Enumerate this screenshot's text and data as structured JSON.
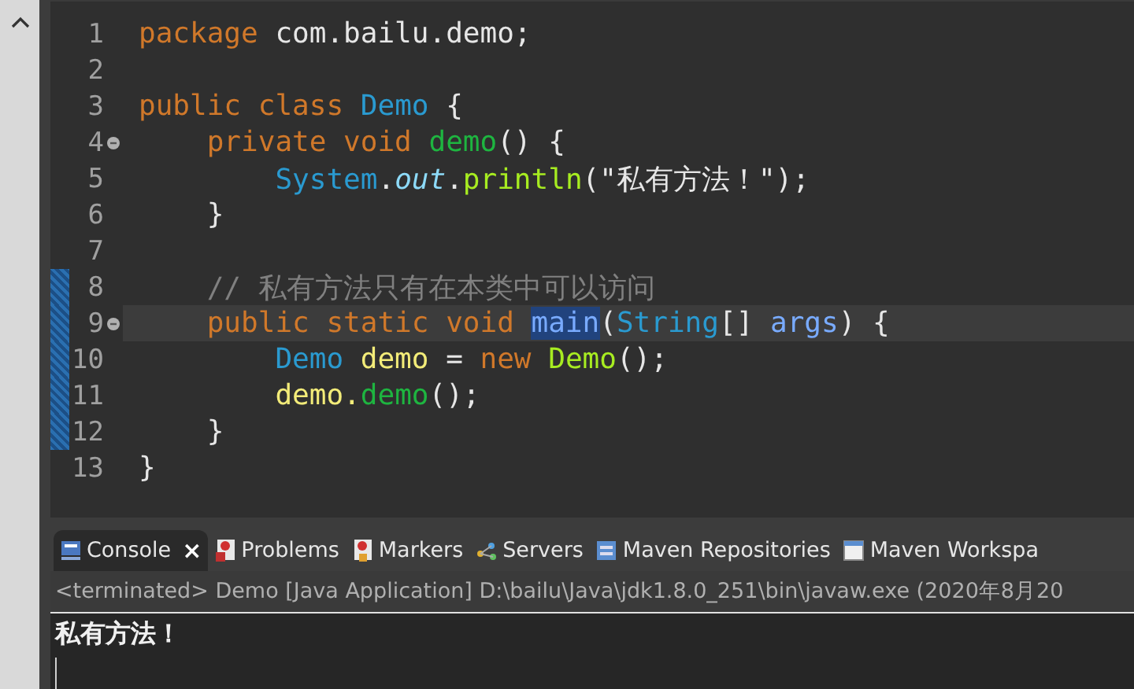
{
  "editor": {
    "lines": [
      {
        "number": "1",
        "fold": false,
        "changed": false,
        "current": false,
        "tokens": [
          {
            "text": "package",
            "kind": "keyword"
          },
          {
            "text": " com.bailu.demo;",
            "kind": "plain"
          }
        ]
      },
      {
        "number": "2",
        "fold": false,
        "changed": false,
        "current": false
      },
      {
        "number": "3",
        "fold": false,
        "changed": false,
        "current": false,
        "tokens": [
          {
            "text": "public class ",
            "kind": "keyword"
          },
          {
            "text": "Demo",
            "kind": "type"
          },
          {
            "text": " {",
            "kind": "plain"
          }
        ]
      },
      {
        "number": "4",
        "fold": true,
        "changed": false,
        "current": false,
        "tokens": [
          {
            "text": "    private void ",
            "kind": "keyword"
          },
          {
            "text": "demo",
            "kind": "declaration"
          },
          {
            "text": "() {",
            "kind": "plain"
          }
        ]
      },
      {
        "number": "5",
        "fold": false,
        "changed": false,
        "current": false,
        "tokens": [
          {
            "text": "        System",
            "kind": "type"
          },
          {
            "text": ".",
            "kind": "plain"
          },
          {
            "text": "out",
            "kind": "field"
          },
          {
            "text": ".",
            "kind": "plain"
          },
          {
            "text": "println",
            "kind": "method"
          },
          {
            "text": "(\"私有方法！\");",
            "kind": "plain"
          }
        ]
      },
      {
        "number": "6",
        "fold": false,
        "changed": false,
        "current": false,
        "tokens": [
          {
            "text": "    }",
            "kind": "plain"
          }
        ]
      },
      {
        "number": "7",
        "fold": false,
        "changed": false,
        "current": false
      },
      {
        "number": "8",
        "fold": false,
        "changed": true,
        "current": false,
        "tokens": [
          {
            "text": "    // 私有方法只有在本类中可以访问",
            "kind": "comment"
          }
        ]
      },
      {
        "number": "9",
        "fold": true,
        "changed": true,
        "current": true,
        "tokens": [
          {
            "text": "    public static void ",
            "kind": "keyword"
          },
          {
            "text": "main",
            "kind": "selection"
          },
          {
            "text": "(",
            "kind": "plain"
          },
          {
            "text": "String",
            "kind": "type"
          },
          {
            "text": "[] ",
            "kind": "plain"
          },
          {
            "text": "args",
            "kind": "parameter"
          },
          {
            "text": ") {",
            "kind": "plain"
          }
        ]
      },
      {
        "number": "10",
        "fold": false,
        "changed": true,
        "current": false,
        "tokens": [
          {
            "text": "        Demo",
            "kind": "type"
          },
          {
            "text": " demo",
            "kind": "variable"
          },
          {
            "text": " = ",
            "kind": "plain"
          },
          {
            "text": "new ",
            "kind": "keyword"
          },
          {
            "text": "Demo",
            "kind": "method"
          },
          {
            "text": "();",
            "kind": "plain"
          }
        ]
      },
      {
        "number": "11",
        "fold": false,
        "changed": true,
        "current": false,
        "tokens": [
          {
            "text": "        demo.",
            "kind": "variable"
          },
          {
            "text": "demo",
            "kind": "declaration"
          },
          {
            "text": "();",
            "kind": "plain"
          }
        ]
      },
      {
        "number": "12",
        "fold": false,
        "changed": true,
        "current": false,
        "tokens": [
          {
            "text": "    }",
            "kind": "plain"
          }
        ]
      },
      {
        "number": "13",
        "fold": false,
        "changed": false,
        "current": false,
        "tokens": [
          {
            "text": "}",
            "kind": "plain"
          }
        ]
      }
    ]
  },
  "panel": {
    "tabs": [
      {
        "label": "Console",
        "selected": true,
        "close": "×"
      },
      {
        "label": "Problems",
        "selected": false
      },
      {
        "label": "Markers",
        "selected": false
      },
      {
        "label": "Servers",
        "selected": false
      },
      {
        "label": "Maven Repositories",
        "selected": false
      },
      {
        "label": "Maven Workspa",
        "selected": false
      }
    ],
    "header": "<terminated> Demo [Java Application] D:\\bailu\\Java\\jdk1.8.0_251\\bin\\javaw.exe (2020年8月20",
    "output": "私有方法！"
  }
}
